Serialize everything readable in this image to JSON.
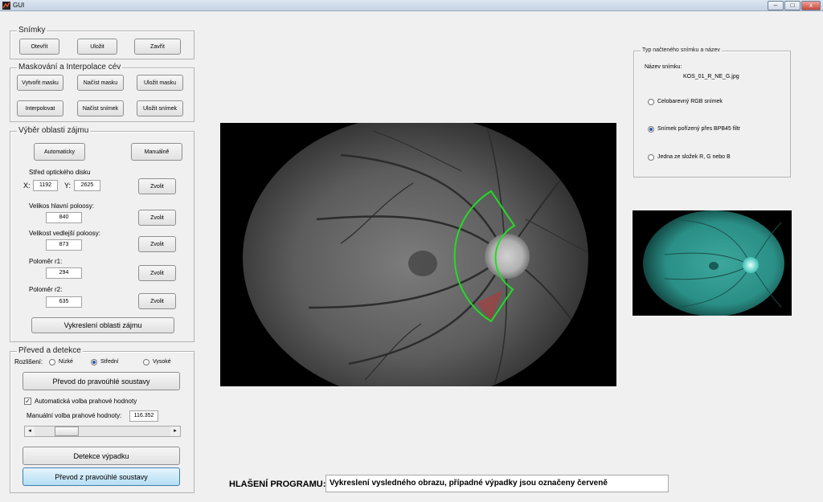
{
  "window": {
    "title": "GUI",
    "buttons": [
      "–",
      "□",
      "x"
    ]
  },
  "panels": {
    "snimky": {
      "title": "Snímky",
      "buttons": [
        "Otevřít",
        "Uložit",
        "Zavřít"
      ]
    },
    "maskovani": {
      "title": "Maskování a Interpolace cév",
      "buttons": [
        "Vytvořit masku",
        "Načíst masku",
        "Uložit masku",
        "Interpolovat",
        "Načíst snímek",
        "Uložit snímek"
      ]
    },
    "vyber": {
      "title": "Výběr oblasti zájmu",
      "auto_button": "Automaticky",
      "manual_button": "Manuálně",
      "center_label": "Střed optického disku",
      "x_label": "X:",
      "x_value": "1192",
      "y_label": "Y:",
      "y_value": "2625",
      "major_label": "Velikos hlavní poloosy:",
      "major_value": "840",
      "minor_label": "Velikost vedlejší poloosy:",
      "minor_value": "873",
      "r1_label": "Poloměr r1:",
      "r1_value": "294",
      "r2_label": "Poloměr r2:",
      "r2_value": "635",
      "choose_button": "Zvolit",
      "draw_button": "Vykreslení oblasti zájmu"
    },
    "prevod": {
      "title": "Převed a detekce",
      "resolution_label": "Rozlišení:",
      "resolution_options": [
        "Nízké",
        "Střední",
        "Vysoké"
      ],
      "resolution_selected": 1,
      "convert_button": "Převod do pravoúhlé soustavy",
      "auto_threshold_label": "Automatická volba prahové hodnoty",
      "auto_threshold_checked": true,
      "manual_threshold_label": "Manuální volba prahové hodnoty:",
      "manual_threshold_value": "116.352",
      "slider_fraction": 0.18,
      "detect_button": "Detekce výpadku",
      "convert_back_button": "Převod z pravoúhlé soustavy"
    },
    "typ": {
      "title": "Typ načteného snímku a název",
      "name_label": "Název snímku:",
      "file_name": "KOS_01_R_NE_G.jpg",
      "options": [
        "Celobarevný RGB snímek",
        "Snímek pořízený přes BPB45 filtr",
        "Jedna ze složek R, G nebo B"
      ],
      "selected": 1
    }
  },
  "message": {
    "label": "HLAŠENÍ PROGRAMU:",
    "text": "Vykreslení vysledného obrazu, případné výpadky jsou označeny červeně"
  },
  "colors": {
    "roi_outline": "#22dd22",
    "dropout": "#c03030",
    "thumbnail_tint": "#2a8f86"
  }
}
